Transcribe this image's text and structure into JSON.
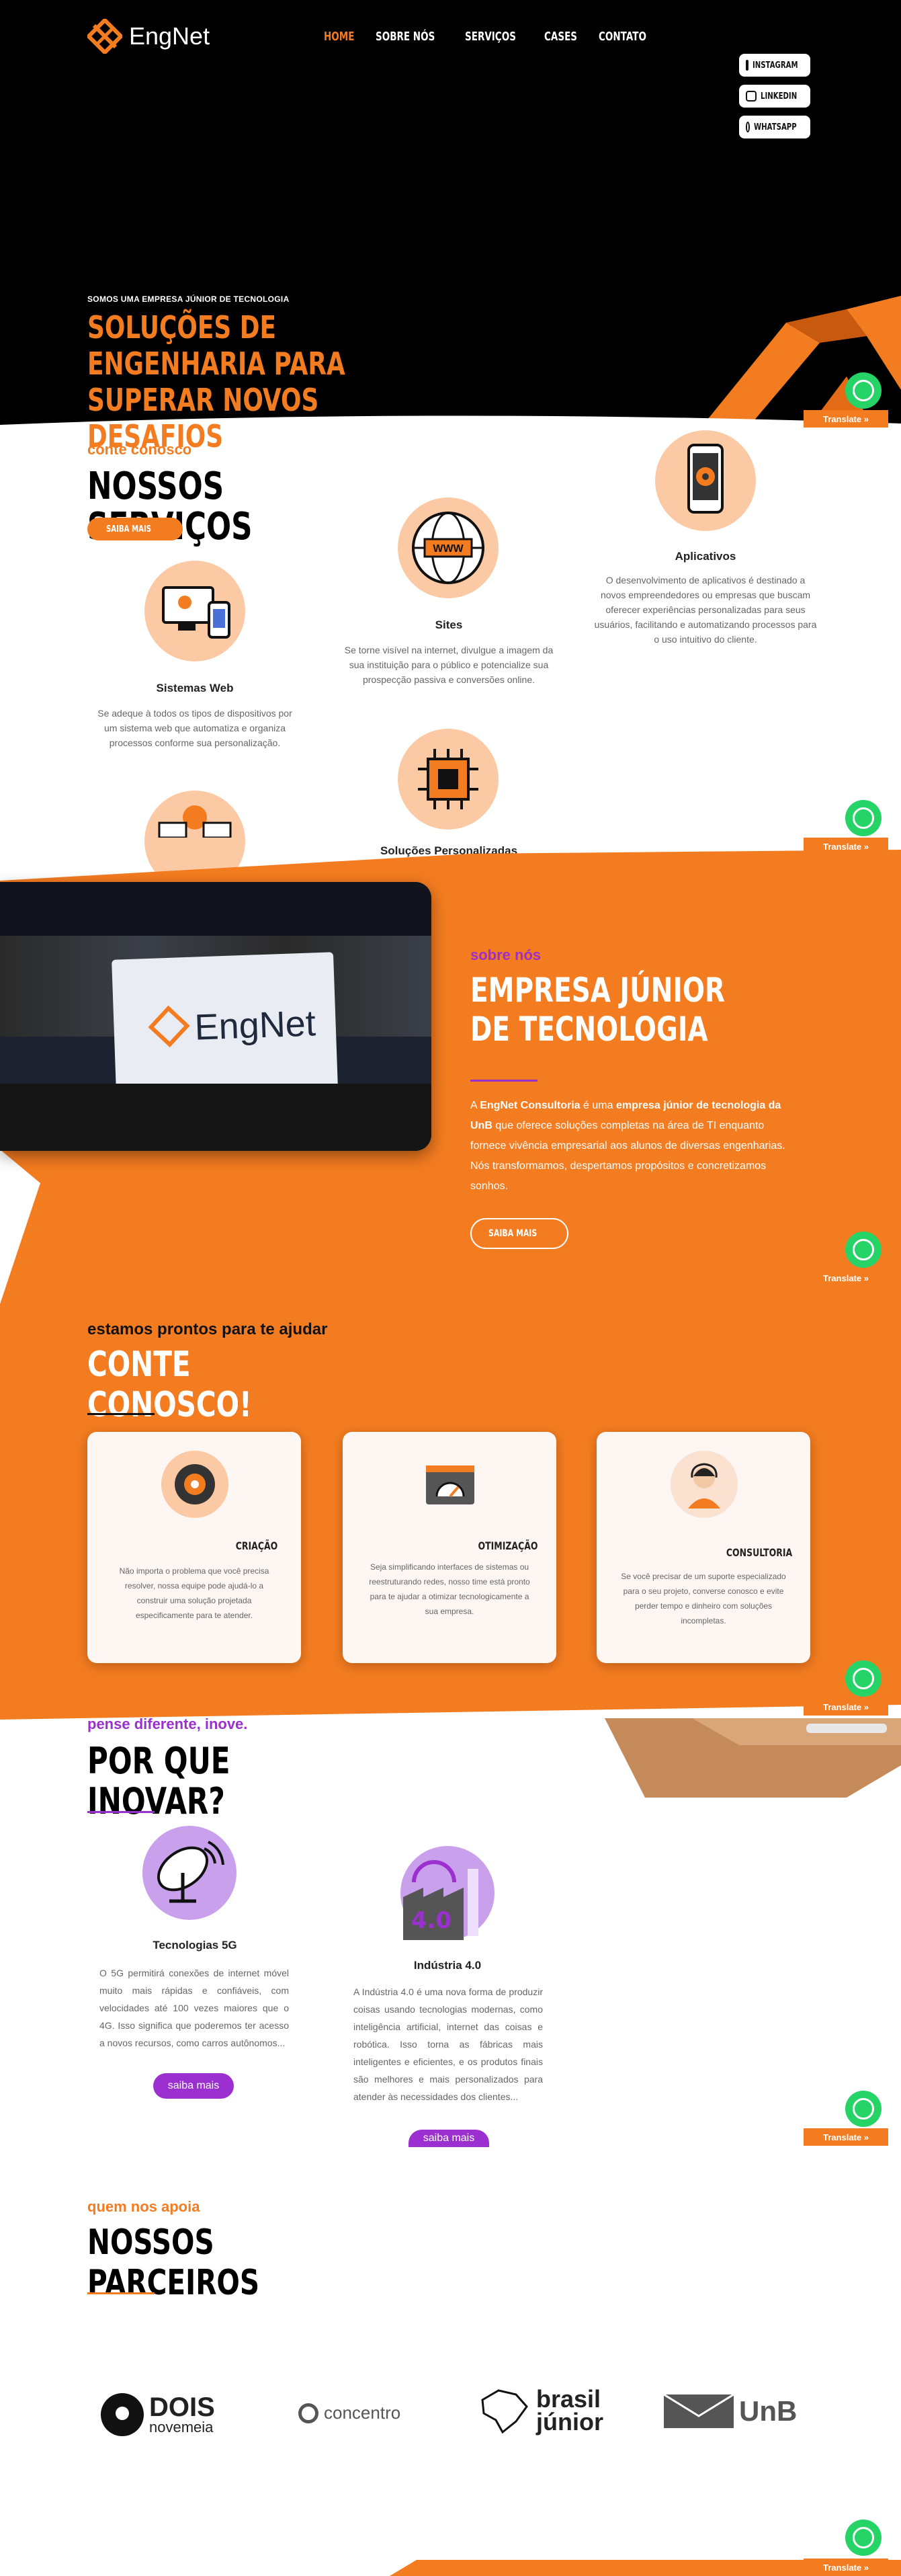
{
  "brand": {
    "name": "EngNet"
  },
  "nav": {
    "items": [
      "HOME",
      "SOBRE NÓS",
      "SERVIÇOS",
      "CASES",
      "CONTATO"
    ]
  },
  "social": {
    "instagram": "INSTAGRAM",
    "linkedin": "LINKEDIN",
    "whatsapp": "WHATSAPP"
  },
  "hero": {
    "kicker": "SOMOS UMA EMPRESA JÚNIOR DE TECNOLOGIA",
    "title": "SOLUÇÕES DE ENGENHARIA PARA SUPERAR NOVOS DESAFIOS"
  },
  "translate": "Translate »",
  "services": {
    "kicker": "conte conosco",
    "title": "NOSSOS SERVIÇOS",
    "button": "SAIBA MAIS",
    "items": [
      {
        "name": "Sistemas Web",
        "desc": "Se adeque à todos os tipos de dispositivos por um sistema web que automatiza e organiza processos conforme sua personalização."
      },
      {
        "name": "Sites",
        "desc": "Se torne visível na internet, divulgue a imagem da sua instituição para o público e potencialize sua prospecção passiva e conversões online."
      },
      {
        "name": "Aplicativos",
        "desc": "O desenvolvimento de aplicativos é destinado a novos empreendedores ou empresas que buscam oferecer experiências personalizadas para seus usuários, facilitando e automatizando processos para o uso intuitivo do cliente."
      },
      {
        "name": "Soluções Personalizadas",
        "desc": ""
      }
    ],
    "www": "WWW"
  },
  "about": {
    "kicker": "sobre nós",
    "title": "EMPRESA JÚNIOR DE TECNOLOGIA",
    "p1": "A ",
    "b1": "EngNet Consultoria",
    "p2": " é uma ",
    "b2": "empresa júnior de tecnologia da UnB",
    "p3": " que oferece soluções completas na área de TI enquanto fornece vivência empresarial aos alunos de diversas engenharias. Nós transformamos, despertamos propósitos e concretizamos sonhos.",
    "button": "SAIBA MAIS",
    "banner": "EngNet"
  },
  "help": {
    "kicker": "estamos prontos para te ajudar",
    "title": "CONTE CONOSCO!",
    "cards": [
      {
        "title": "CRIAÇÃO",
        "desc": "Não importa o problema que você precisa resolver, nossa equipe pode ajudá-lo a construir uma solução projetada especificamente para te atender."
      },
      {
        "title": "OTIMIZAÇÃO",
        "desc": "Seja simplificando interfaces de sistemas ou reestruturando redes, nosso time está pronto para te ajudar a otimizar tecnologicamente a sua empresa."
      },
      {
        "title": "CONSULTORIA",
        "desc": "Se você precisar de um suporte especializado para o seu projeto, converse conosco e evite perder tempo e dinheiro com soluções incompletas."
      }
    ]
  },
  "innovate": {
    "kicker": "pense diferente, inove.",
    "title": "POR QUE INOVAR?",
    "items": [
      {
        "name": "Tecnologias 5G",
        "desc": "O 5G permitirá conexões de internet móvel muito mais rápidas e confiáveis, com velocidades até 100 vezes maiores que o 4G. Isso significa que poderemos ter acesso a novos recursos, como carros autônomos...",
        "button": "saiba mais"
      },
      {
        "name": "Indústria 4.0",
        "desc": "A Indústria 4.0 é uma nova forma de produzir coisas usando tecnologias modernas, como inteligência artificial, internet das coisas e robótica. Isso torna as fábricas mais inteligentes e eficientes, e os produtos finais são melhores e mais personalizados para atender às necessidades dos clientes...",
        "button": "saiba mais",
        "badge": "4.0"
      }
    ]
  },
  "partners": {
    "kicker": "quem nos apoia",
    "title": "NOSSOS PARCEIROS",
    "items": [
      {
        "name": "DOIS",
        "sub": "novemeia"
      },
      {
        "name": "concentro"
      },
      {
        "name": "brasil",
        "sub": "júnior"
      },
      {
        "name": "UnB"
      }
    ]
  },
  "colors": {
    "orange": "#f47c20",
    "purple": "#9b2fd0",
    "black": "#000000",
    "peach": "#fbc9a4",
    "green": "#25d366"
  }
}
